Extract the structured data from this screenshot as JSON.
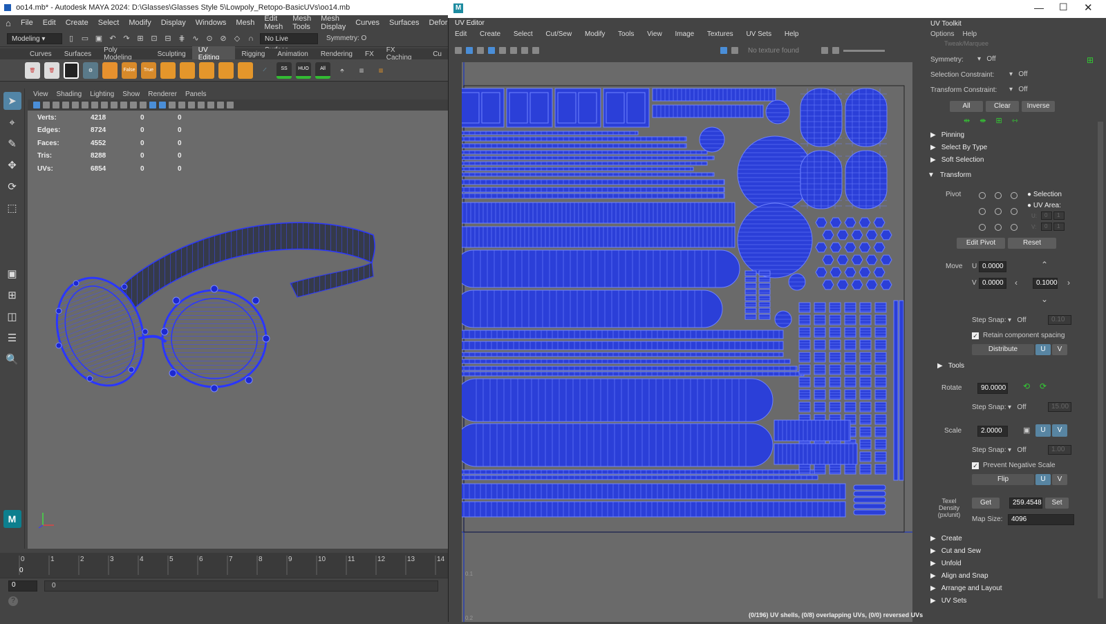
{
  "main_window": {
    "title": "oo14.mb* - Autodesk MAYA 2024: D:\\Glasses\\Glasses Style 5\\Lowpoly_Retopo-BasicUVs\\oo14.mb",
    "menus": [
      "File",
      "Edit",
      "Create",
      "Select",
      "Modify",
      "Display",
      "Windows",
      "Mesh",
      "Edit Mesh",
      "Mesh Tools",
      "Mesh Display",
      "Curves",
      "Surfaces",
      "Deform"
    ],
    "mode": "Modeling",
    "live_surface": "No Live Surface",
    "symmetry": "Symmetry: O"
  },
  "shelf": {
    "tabs": [
      "Curves",
      "Surfaces",
      "Poly Modeling",
      "Sculpting",
      "UV Editing",
      "Rigging",
      "Animation",
      "Rendering",
      "FX",
      "FX Caching",
      "Cu"
    ],
    "active": "UV Editing",
    "labels": [
      "False",
      "True",
      "SS",
      "HUO",
      "All"
    ]
  },
  "viewport": {
    "menus": [
      "View",
      "Shading",
      "Lighting",
      "Show",
      "Renderer",
      "Panels"
    ],
    "hud": [
      {
        "k": "Verts:",
        "a": "4218",
        "b": "0",
        "c": "0"
      },
      {
        "k": "Edges:",
        "a": "8724",
        "b": "0",
        "c": "0"
      },
      {
        "k": "Faces:",
        "a": "4552",
        "b": "0",
        "c": "0"
      },
      {
        "k": "Tris:",
        "a": "8288",
        "b": "0",
        "c": "0"
      },
      {
        "k": "UVs:",
        "a": "6854",
        "b": "0",
        "c": "0"
      }
    ]
  },
  "timeline": {
    "ticks": [
      "0",
      "1",
      "2",
      "3",
      "4",
      "5",
      "6",
      "7",
      "8",
      "9",
      "10",
      "11",
      "12",
      "13",
      "14"
    ],
    "current": "0",
    "start": "0",
    "range_start": "0"
  },
  "uv_editor": {
    "title": "UV Editor",
    "menus": [
      "Edit",
      "Create",
      "Select",
      "Cut/Sew",
      "Modify",
      "Tools",
      "View",
      "Image",
      "Textures",
      "UV Sets",
      "Help"
    ],
    "texture": "No texture found",
    "status": "(0/196) UV shells, (0/8) overlapping UVs, (0/0) reversed UVs",
    "axis_labels": [
      "0.1",
      "0.2"
    ]
  },
  "toolkit": {
    "title": "UV Toolkit",
    "menus": [
      "Options",
      "Help"
    ],
    "tweak": "Tweak/Marquee",
    "symmetry_label": "Symmetry:",
    "symmetry": "Off",
    "sel_constraint_label": "Selection Constraint:",
    "sel_constraint": "Off",
    "xf_constraint_label": "Transform Constraint:",
    "xf_constraint": "Off",
    "btn_all": "All",
    "btn_clear": "Clear",
    "btn_inverse": "Inverse",
    "sections_top": [
      "Pinning",
      "Select By Type",
      "Soft Selection"
    ],
    "transform": "Transform",
    "pivot": "Pivot",
    "pivot_selection": "Selection",
    "pivot_uvarea": "UV Area:",
    "u_label": "U:",
    "v_label": "V:",
    "pivot_val": "0",
    "pivot_val2": "1",
    "edit_pivot": "Edit Pivot",
    "reset": "Reset",
    "move": "Move",
    "move_u": "0.0000",
    "move_v": "0.0000",
    "move_step": "0.1000",
    "U": "U",
    "V": "V",
    "step_snap": "Step Snap:",
    "off": "Off",
    "move_snap": "0.10",
    "retain": "Retain component spacing",
    "distribute": "Distribute",
    "tools": "Tools",
    "rotate": "Rotate",
    "rotate_val": "90.0000",
    "rotate_snap": "15.00",
    "scale": "Scale",
    "scale_val": "2.0000",
    "scale_snap": "1.00",
    "prevent": "Prevent Negative Scale",
    "flip": "Flip",
    "texel": "Texel Density (px/unit)",
    "get": "Get",
    "texel_val": "259.4548",
    "set": "Set",
    "map_size_label": "Map Size:",
    "map_size": "4096",
    "sections_bottom": [
      "Create",
      "Cut and Sew",
      "Unfold",
      "Align and Snap",
      "Arrange and Layout",
      "UV Sets"
    ]
  },
  "colors": {
    "uv_blue": "#2b3fd8",
    "wire": "#6f83ff",
    "bg": "#444444"
  }
}
